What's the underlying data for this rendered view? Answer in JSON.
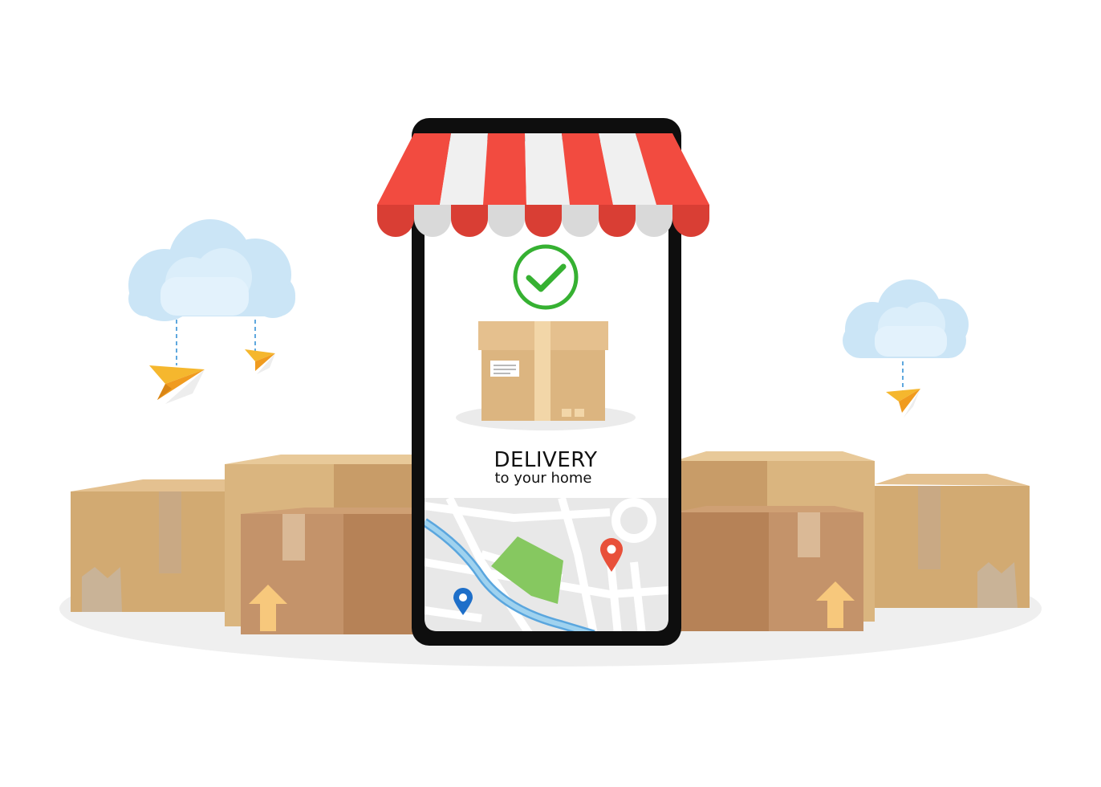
{
  "screen": {
    "headline": "DELIVERY",
    "subheadline": "to your home",
    "status_icon": "checkmark-circle-icon",
    "package_icon": "cardboard-box-icon"
  },
  "map": {
    "pins": [
      {
        "name": "destination-pin",
        "color": "#e8503a"
      },
      {
        "name": "origin-pin",
        "color": "#1e6fc9"
      }
    ],
    "park_color": "#86c860",
    "river_color": "#9fd2ef"
  },
  "colors": {
    "awning_red": "#f24b40",
    "awning_red_dark": "#d93e34",
    "awning_white": "#f0f0f0",
    "awning_white_dark": "#d9d9d9",
    "phone_frame": "#0e0e0e",
    "check_green": "#36b132",
    "box_light": "#dcb580",
    "box_dark": "#c19267",
    "cloud_blue": "#cbe5f6",
    "plane_orange": "#f5b72e",
    "floor_shadow": "#efefef"
  }
}
